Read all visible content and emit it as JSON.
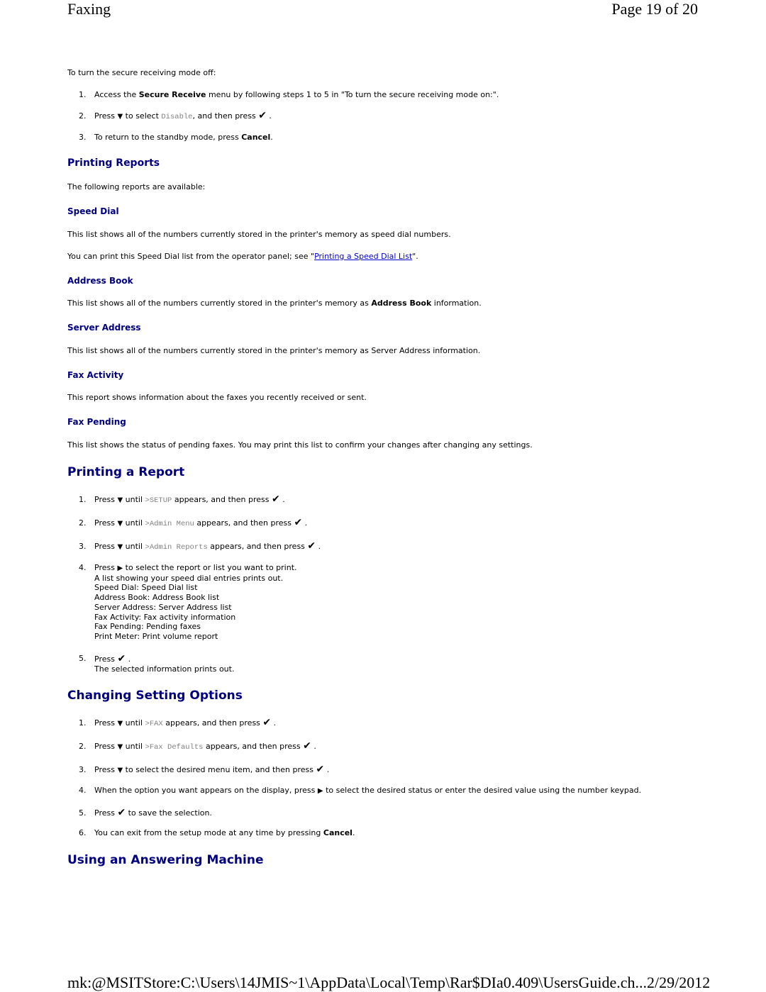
{
  "header": {
    "title": "Faxing",
    "page": "Page 19 of 20"
  },
  "footer": {
    "path": "mk:@MSITStore:C:\\Users\\14JMIS~1\\AppData\\Local\\Temp\\Rar$DIa0.409\\UsersGuide.ch...",
    "date": "2/29/2012"
  },
  "secure_off": {
    "intro": "To turn the secure receiving mode off:",
    "steps": [
      {
        "num": "1.",
        "a": "Access the ",
        "bold": "Secure Receive",
        "b": " menu by following steps 1 to 5 in \"To turn the secure receiving mode on:\"."
      },
      {
        "num": "2.",
        "a": "Press ",
        "b": " to select ",
        "mono": "Disable",
        "c": ", and then press ",
        "d": " ."
      },
      {
        "num": "3.",
        "a": "To return to the standby mode, press ",
        "bold": "Cancel",
        "b": "."
      }
    ]
  },
  "printing_reports": {
    "title": "Printing Reports",
    "intro": "The following reports are available:",
    "speed_dial": {
      "title": "Speed Dial",
      "desc": "This list shows all of the numbers currently stored in the printer's memory as speed dial numbers.",
      "print_pre": "You can print this Speed Dial list from the operator panel; see \"",
      "link": "Printing a Speed Dial List",
      "print_post": "\"."
    },
    "address_book": {
      "title": "Address Book",
      "desc_pre": "This list shows all of the numbers currently stored in the printer's memory as ",
      "desc_bold": "Address Book",
      "desc_post": " information."
    },
    "server_address": {
      "title": "Server Address",
      "desc": "This list shows all of the numbers currently stored in the printer's memory as Server Address information."
    },
    "fax_activity": {
      "title": "Fax Activity",
      "desc": "This report shows information about the faxes you recently received or sent."
    },
    "fax_pending": {
      "title": "Fax Pending",
      "desc": "This list shows the status of pending faxes. You may print this list to confirm your changes after changing any settings."
    }
  },
  "printing_a_report": {
    "title": "Printing a Report",
    "steps": [
      {
        "num": "1.",
        "a": "Press ",
        "b": " until ",
        "mono": ">SETUP",
        "c": " appears, and then press ",
        "d": " ."
      },
      {
        "num": "2.",
        "a": "Press ",
        "b": " until ",
        "mono": ">Admin Menu",
        "c": " appears, and then press ",
        "d": " ."
      },
      {
        "num": "3.",
        "a": "Press ",
        "b": " until ",
        "mono": ">Admin Reports",
        "c": " appears, and then press ",
        "d": " ."
      },
      {
        "num": "4.",
        "a": "Press ",
        "b": " to select the report or list you want to print.",
        "lines": [
          "A list showing your speed dial entries prints out.",
          "Speed Dial: Speed Dial list",
          "Address Book: Address Book list",
          "Server Address: Server Address list",
          "Fax Activity: Fax activity information",
          "Fax Pending: Pending faxes",
          "Print Meter: Print volume report"
        ]
      },
      {
        "num": "5.",
        "a": "Press ",
        "b": " .",
        "line": "The selected information prints out."
      }
    ]
  },
  "changing_settings": {
    "title": "Changing Setting Options",
    "steps": [
      {
        "num": "1.",
        "a": "Press ",
        "b": " until ",
        "mono": ">FAX",
        "c": " appears, and then press ",
        "d": " ."
      },
      {
        "num": "2.",
        "a": "Press ",
        "b": " until ",
        "mono": ">Fax Defaults",
        "c": " appears, and then press ",
        "d": " ."
      },
      {
        "num": "3.",
        "a": "Press ",
        "b": " to select the desired menu item, and then press ",
        "c": " ."
      },
      {
        "num": "4.",
        "a": "When the option you want appears on the display, press ",
        "b": " to select the desired status or enter the desired value using the number keypad."
      },
      {
        "num": "5.",
        "a": "Press ",
        "b": " to save the selection."
      },
      {
        "num": "6.",
        "a": "You can exit from the setup mode at any time by pressing ",
        "bold": "Cancel",
        "b": "."
      }
    ]
  },
  "answering_machine": {
    "title": "Using an Answering Machine"
  },
  "icons": {
    "down": "down-arrow-icon",
    "right": "right-arrow-icon",
    "ok": "checkmark-icon"
  }
}
